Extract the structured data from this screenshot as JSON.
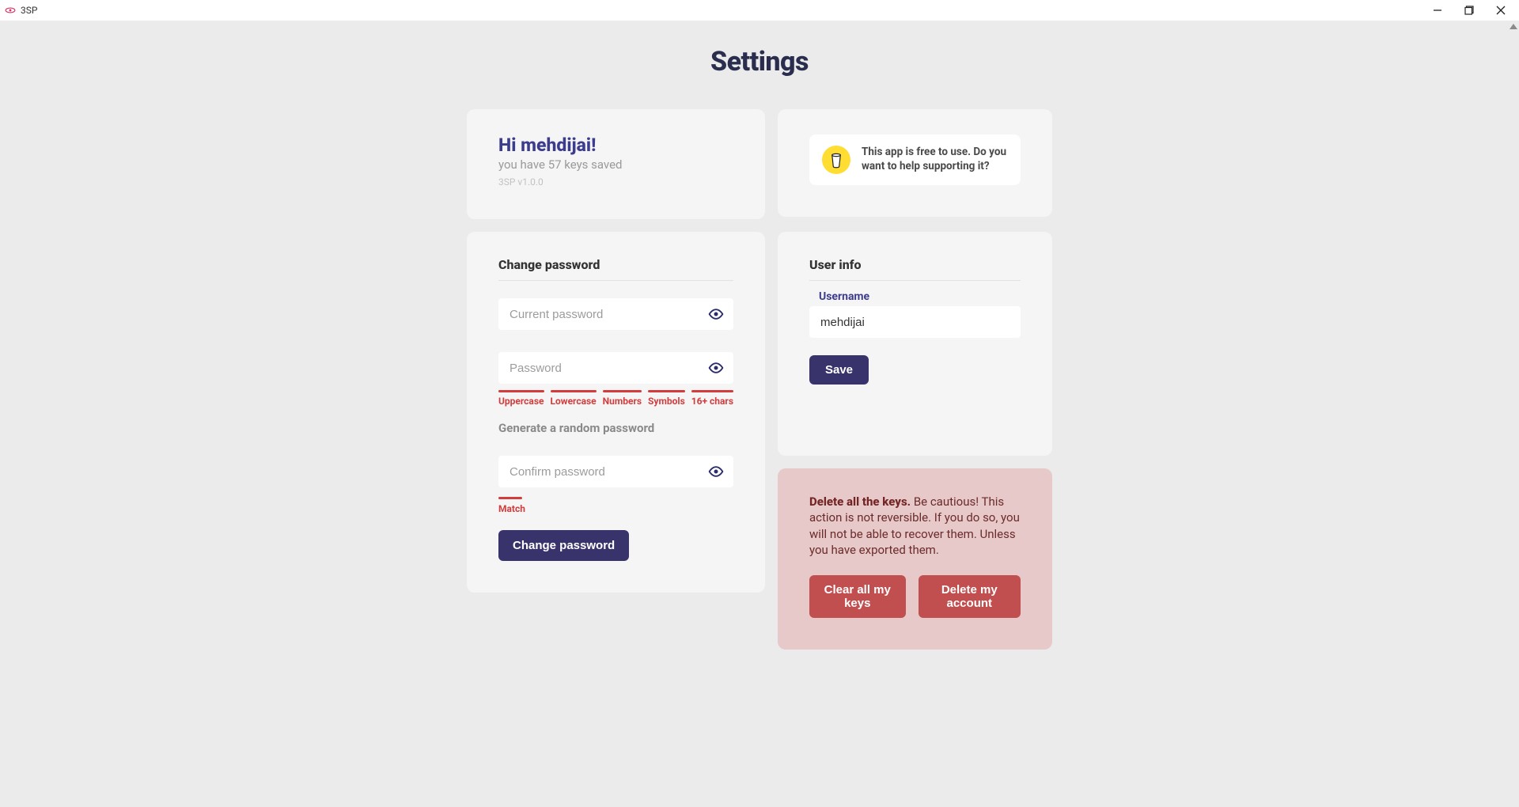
{
  "window": {
    "title": "3SP"
  },
  "page": {
    "title": "Settings"
  },
  "greeting": {
    "hi": "Hi mehdijai!",
    "subtitle": "you have 57 keys saved",
    "version": "3SP v1.0.0"
  },
  "support": {
    "text": "This app is free to use. Do you want to help supporting it?"
  },
  "passwordCard": {
    "title": "Change password",
    "currentPlaceholder": "Current password",
    "newPlaceholder": "Password",
    "confirmPlaceholder": "Confirm password",
    "requirements": [
      "Uppercase",
      "Lowercase",
      "Numbers",
      "Symbols",
      "16+ chars"
    ],
    "generateLabel": "Generate a random password",
    "matchLabel": "Match",
    "submitLabel": "Change password"
  },
  "userCard": {
    "title": "User info",
    "usernameLabel": "Username",
    "usernameValue": "mehdijai",
    "saveLabel": "Save"
  },
  "dangerCard": {
    "boldLead": "Delete all the keys.",
    "body": " Be cautious! This action is not reversible. If you do so, you will not be able to recover them. Unless you have exported them.",
    "clearLabel": "Clear all my keys",
    "deleteLabel": "Delete my account"
  }
}
